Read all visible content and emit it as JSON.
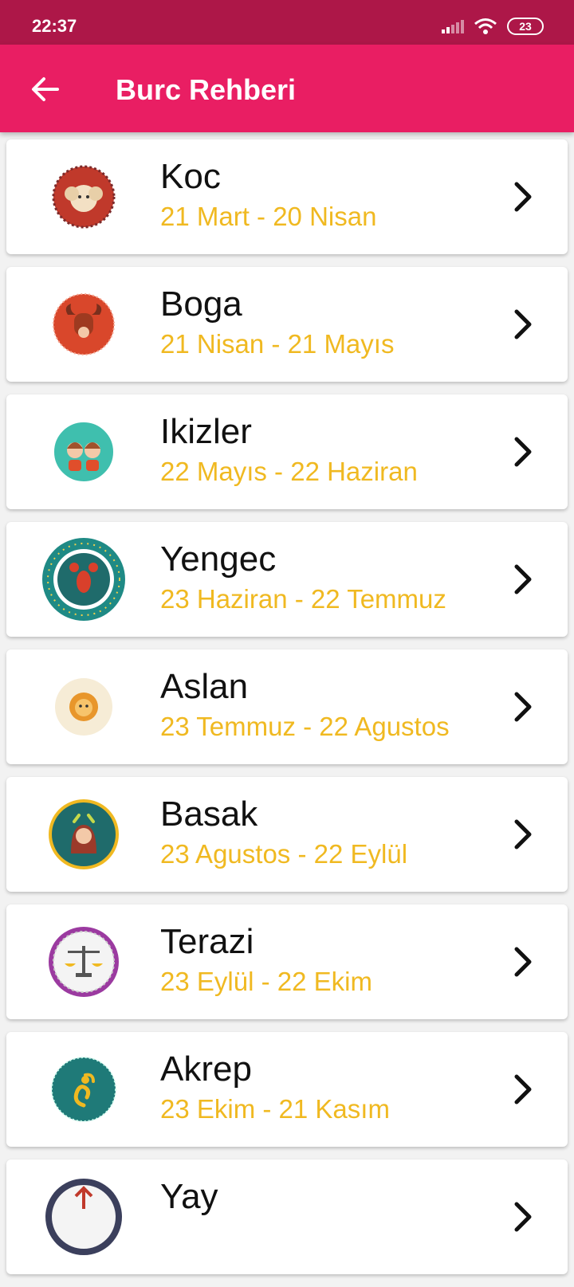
{
  "status": {
    "time": "22:37",
    "battery": "23"
  },
  "header": {
    "title": "Burc Rehberi"
  },
  "signs": [
    {
      "name": "Koc",
      "dates": "21 Mart - 20 Nisan",
      "icon": "ram-icon"
    },
    {
      "name": "Boga",
      "dates": "21 Nisan - 21 Mayıs",
      "icon": "bull-icon"
    },
    {
      "name": "Ikizler",
      "dates": "22 Mayıs - 22 Haziran",
      "icon": "twins-icon"
    },
    {
      "name": "Yengec",
      "dates": "23 Haziran - 22 Temmuz",
      "icon": "crab-icon"
    },
    {
      "name": "Aslan",
      "dates": "23 Temmuz - 22 Agustos",
      "icon": "lion-icon"
    },
    {
      "name": "Basak",
      "dates": "23 Agustos - 22 Eylül",
      "icon": "maiden-icon"
    },
    {
      "name": "Terazi",
      "dates": "23 Eylül - 22 Ekim",
      "icon": "scales-icon"
    },
    {
      "name": "Akrep",
      "dates": "23 Ekim - 21 Kasım",
      "icon": "scorpion-icon"
    },
    {
      "name": "Yay",
      "dates": "",
      "icon": "archer-icon"
    }
  ],
  "colors": {
    "status_bar": "#ad1748",
    "app_bar": "#e91e63",
    "date_text": "#f0b921"
  }
}
